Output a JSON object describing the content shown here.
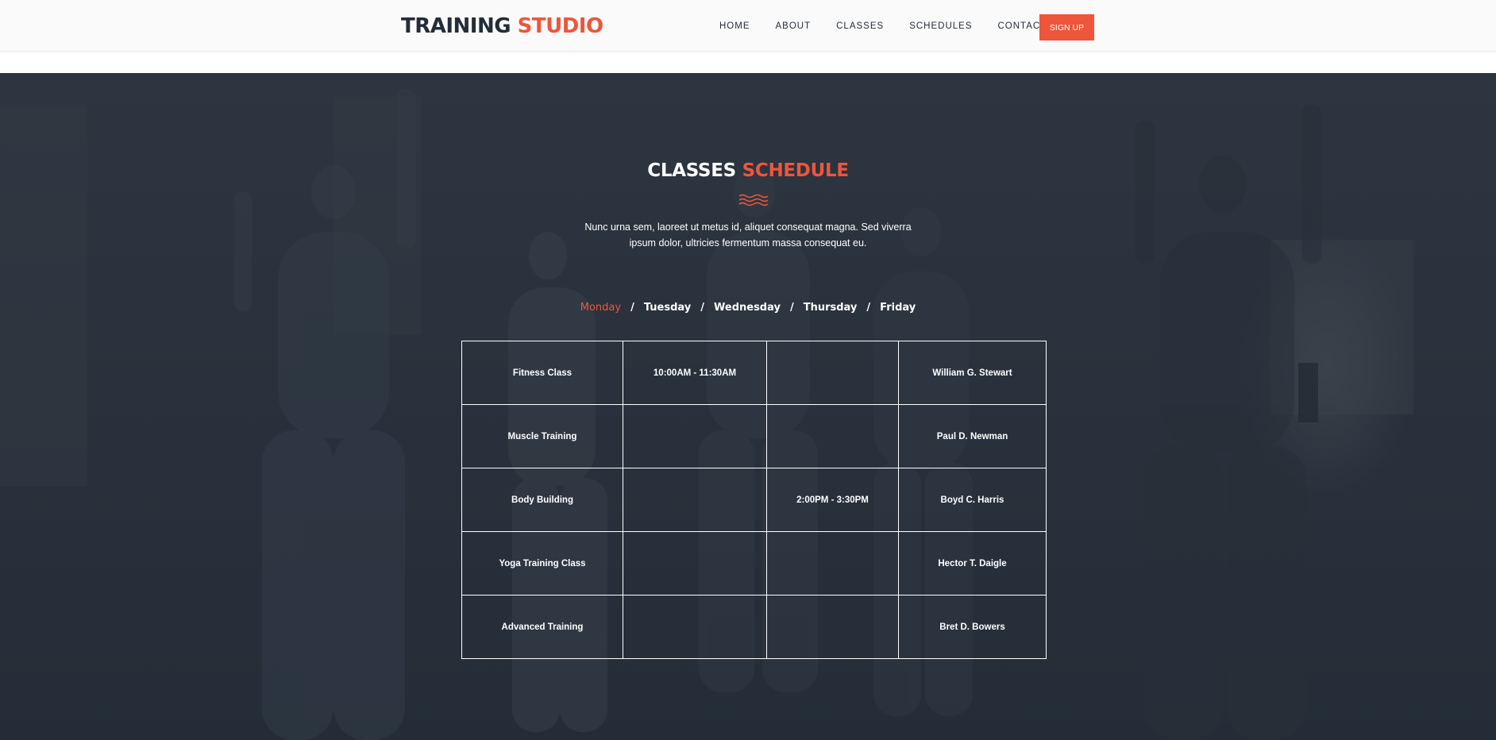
{
  "header": {
    "logo_part1": "TRAINING",
    "logo_part2": "STUDIO",
    "nav": [
      "HOME",
      "ABOUT",
      "CLASSES",
      "SCHEDULES",
      "CONTACT"
    ],
    "signup_label": "SIGN UP"
  },
  "schedule": {
    "title_part1": "CLASSES",
    "title_part2": "SCHEDULE",
    "description": "Nunc urna sem, laoreet ut metus id, aliquet consequat magna. Sed viverra ipsum dolor, ultricies fermentum massa consequat eu.",
    "days": [
      "Monday",
      "Tuesday",
      "Wednesday",
      "Thursday",
      "Friday"
    ],
    "active_day": "Monday",
    "rows": [
      [
        "Fitness Class",
        "10:00AM - 11:30AM",
        "",
        "William G. Stewart"
      ],
      [
        "Muscle Training",
        "",
        "",
        "Paul D. Newman"
      ],
      [
        "Body Building",
        "",
        "2:00PM - 3:30PM",
        "Boyd C. Harris"
      ],
      [
        "Yoga Training Class",
        "",
        "",
        "Hector T. Daigle"
      ],
      [
        "Advanced Training",
        "",
        "",
        "Bret D. Bowers"
      ]
    ]
  },
  "colors": {
    "accent": "#ed563b",
    "dark": "#232d39",
    "overlay": "#2c333d"
  },
  "icons": {
    "divider": "waves-icon"
  }
}
